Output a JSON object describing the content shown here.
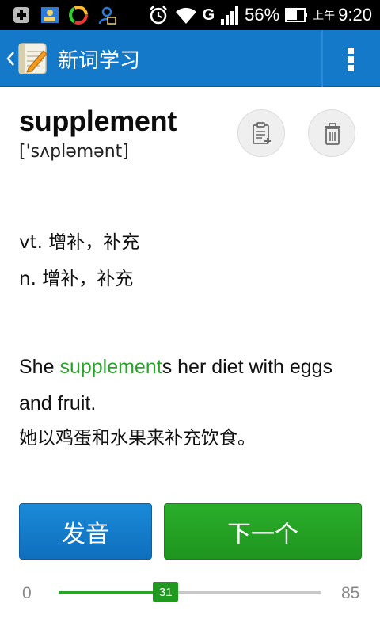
{
  "status_bar": {
    "network_label": "G",
    "network_sub": "R",
    "battery_percent": "56%",
    "time_prefix": "上午",
    "time": "9:20"
  },
  "header": {
    "title": "新词学习",
    "icons": [
      "back-chevron-icon",
      "app-notepad-icon",
      "overflow-menu-icon"
    ]
  },
  "word": {
    "text": "supplement",
    "phonetic": "['sʌpləmənt]"
  },
  "meanings": [
    "vt. 增补，补充",
    "n. 增补，补充"
  ],
  "example": {
    "before": "She ",
    "highlight": "supplement",
    "after": "s her diet with eggs and fruit.",
    "translation": "她以鸡蛋和水果来补充饮食。"
  },
  "buttons": {
    "pronounce": "发音",
    "next": "下一个"
  },
  "progress": {
    "min": "0",
    "max": "85",
    "current": "31",
    "value": 31,
    "total": 85
  },
  "colors": {
    "action_bar": "#1379c8",
    "highlight_green": "#2aa32a",
    "pronounce_blue": "#1379c8",
    "next_green": "#22a022"
  }
}
